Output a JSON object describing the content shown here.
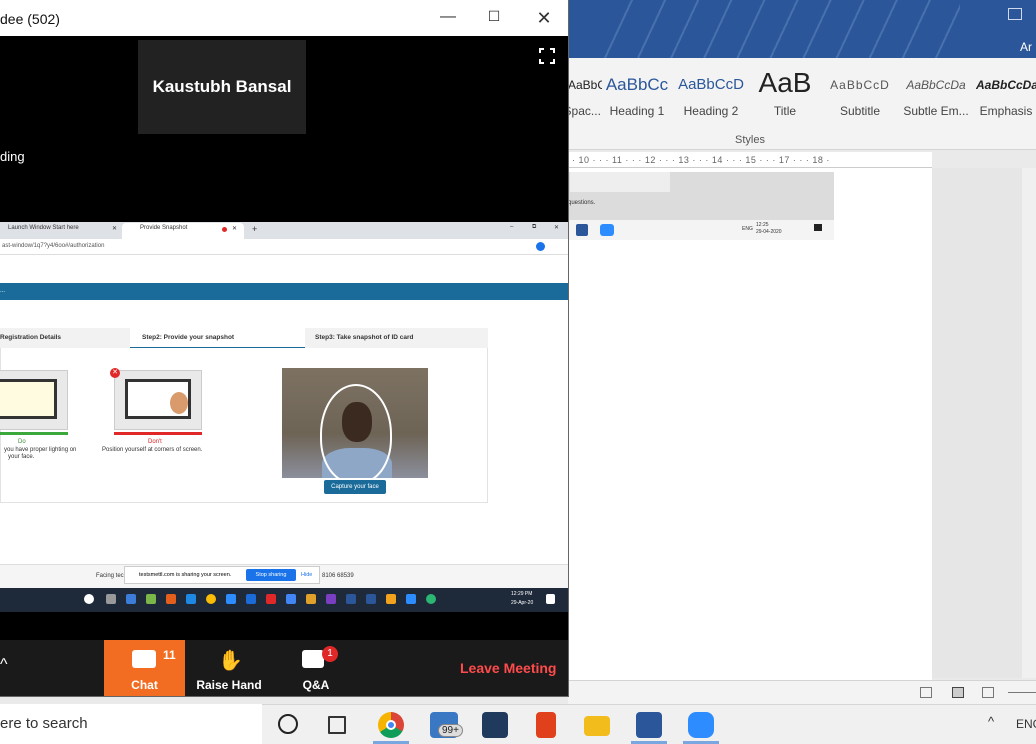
{
  "word": {
    "account_initial": "Ar",
    "styles": [
      {
        "preview": "AaBbCcDc",
        "label": "¶ No Spac...",
        "style": "normal"
      },
      {
        "preview": "AaBbCc",
        "label": "Heading 1",
        "style": "h1"
      },
      {
        "preview": "AaBbCcD",
        "label": "Heading 2",
        "style": "h2"
      },
      {
        "preview": "AaB",
        "label": "Title",
        "style": "title"
      },
      {
        "preview": "AaBbCcD",
        "label": "Subtitle",
        "style": "sub"
      },
      {
        "preview": "AaBbCcDa",
        "label": "Subtle Em...",
        "style": "subtle"
      },
      {
        "preview": "AaBbCcDa",
        "label": "Emphasis",
        "style": "emph"
      }
    ],
    "styles_group_label": "Styles",
    "ruler_text": "· 10 · · · 11 · · · 12 · · · 13 · · · 14 · · · 15 · · · 17 · · · 18 ·",
    "thumb_text": "questions.",
    "thumb_time": "12:25",
    "thumb_date": "29-04-2020",
    "thumb_lang": "ENG"
  },
  "zoom": {
    "window_title": "dee (502)",
    "participant_name": "Kaustubh Bansal",
    "recording_text": "ding",
    "chat_label": "Chat",
    "chat_badge": "11",
    "raise_hand_label": "Raise Hand",
    "qa_label": "Q&A",
    "qa_badge": "1",
    "leave_label": "Leave Meeting"
  },
  "shared": {
    "tab1": "Launch Window Start here",
    "tab2": "Provide Snapshot",
    "url": "ast-window/1q7?y4/6oo#/authorization",
    "banner": "...",
    "step1": "Registration Details",
    "step2": "Step2: Provide your snapshot",
    "step3": "Step3: Take snapshot of ID card",
    "do_label": "Do",
    "do_text1": "you have proper lighting on",
    "do_text2": "your face.",
    "dont_label": "Don't",
    "dont_text": "Position yourself at corners of screen.",
    "capture_label": "Capture your face",
    "sharing_text": "testsmettl.com is sharing your screen.",
    "stop_sharing": "Stop sharing",
    "hide": "Hide",
    "facing_text": "Facing tec",
    "phone_text": "8106 68539",
    "inner_time": "12:29 PM",
    "inner_date": "29-Apr-20"
  },
  "taskbar": {
    "search_text": "ere to search",
    "mail_badge": "99+",
    "lang": "ENG"
  },
  "colors": {
    "word_blue": "#2b579a",
    "zoom_orange": "#f26d21",
    "leave_red": "#ff4b4b",
    "banner_blue": "#1b6b9a"
  }
}
